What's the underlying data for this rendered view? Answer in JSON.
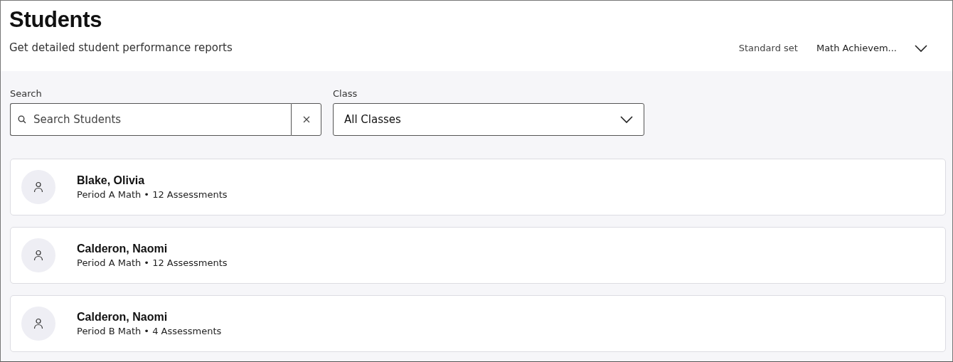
{
  "header": {
    "title": "Students",
    "subtitle": "Get detailed student performance reports",
    "standard_set": {
      "label": "Standard set",
      "value": "Math Achievem..."
    }
  },
  "filters": {
    "search": {
      "label": "Search",
      "placeholder": "Search Students"
    },
    "class": {
      "label": "Class",
      "value": "All Classes"
    }
  },
  "students": [
    {
      "name": "Blake, Olivia",
      "details": "Period A Math • 12 Assessments"
    },
    {
      "name": "Calderon, Naomi",
      "details": "Period A Math • 12 Assessments"
    },
    {
      "name": "Calderon, Naomi",
      "details": "Period B Math • 4 Assessments"
    }
  ]
}
